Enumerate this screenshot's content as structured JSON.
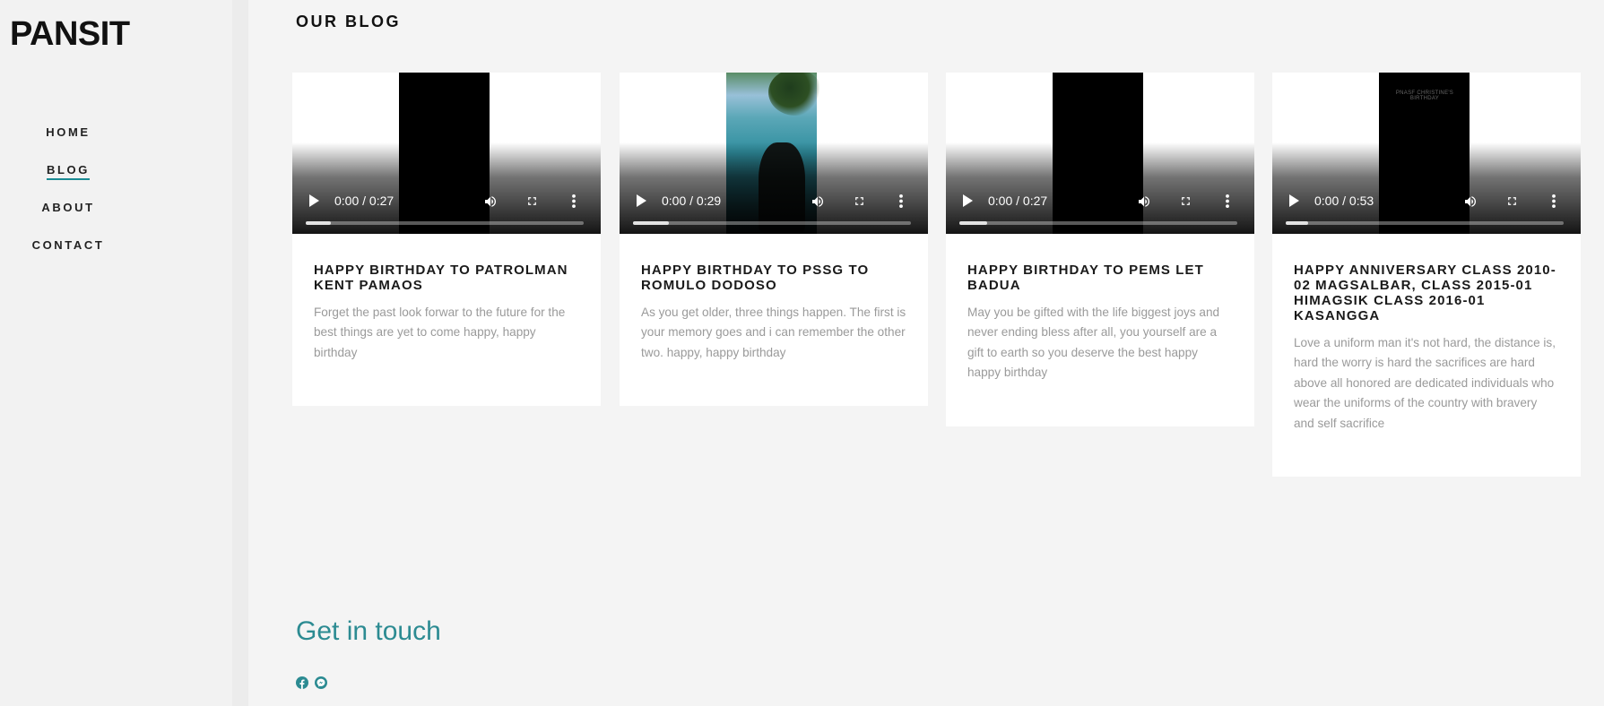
{
  "brand": "PANSIT",
  "nav": [
    {
      "label": "HOME",
      "active": false
    },
    {
      "label": "BLOG",
      "active": true
    },
    {
      "label": "ABOUT",
      "active": false
    },
    {
      "label": "CONTACT",
      "active": false
    }
  ],
  "section_title": "OUR BLOG",
  "posts": [
    {
      "title": "HAPPY BIRTHDAY TO PATROLMAN KENT PAMAOS",
      "excerpt": "Forget the past look forwar to the future for the best things are yet to come happy, happy birthday",
      "video_time": "0:00 / 0:27",
      "video_progress": 0.09,
      "poster": "black"
    },
    {
      "title": "HAPPY BIRTHDAY TO PSSG TO ROMULO DODOSO",
      "excerpt": "As you get older, three things happen. The first is your memory goes and i can remember the other two. happy, happy birthday",
      "video_time": "0:00 / 0:29",
      "video_progress": 0.13,
      "poster": "beach-photo"
    },
    {
      "title": "HAPPY BIRTHDAY TO PEMS LET BADUA",
      "excerpt": "May you be gifted with the life biggest joys and never ending bless after all, you yourself are a gift to earth so you deserve the best happy happy birthday",
      "video_time": "0:00 / 0:27",
      "video_progress": 0.1,
      "poster": "black"
    },
    {
      "title": "HAPPY ANNIVERSARY CLASS 2010-02 MAGSALBAR, CLASS 2015-01 HIMAGSIK CLASS 2016-01 KASANGGA",
      "excerpt": "Love a uniform man it's not hard, the distance is, hard the worry is hard the sacrifices are hard above all honored are dedicated individuals who wear the uniforms of the country with bravery and self sacrifice",
      "video_time": "0:00 / 0:53",
      "video_progress": 0.08,
      "poster": "black-with-caption",
      "poster_caption": "PNASF CHRISTINE'S BIRTHDAY"
    }
  ],
  "contact": {
    "title": "Get in touch",
    "social_icons": [
      "facebook-icon",
      "messenger-icon"
    ]
  },
  "colors": {
    "accent": "#2c8b92",
    "sidebar_bg": "#f2f2f2",
    "page_bg": "#f4f4f4"
  }
}
